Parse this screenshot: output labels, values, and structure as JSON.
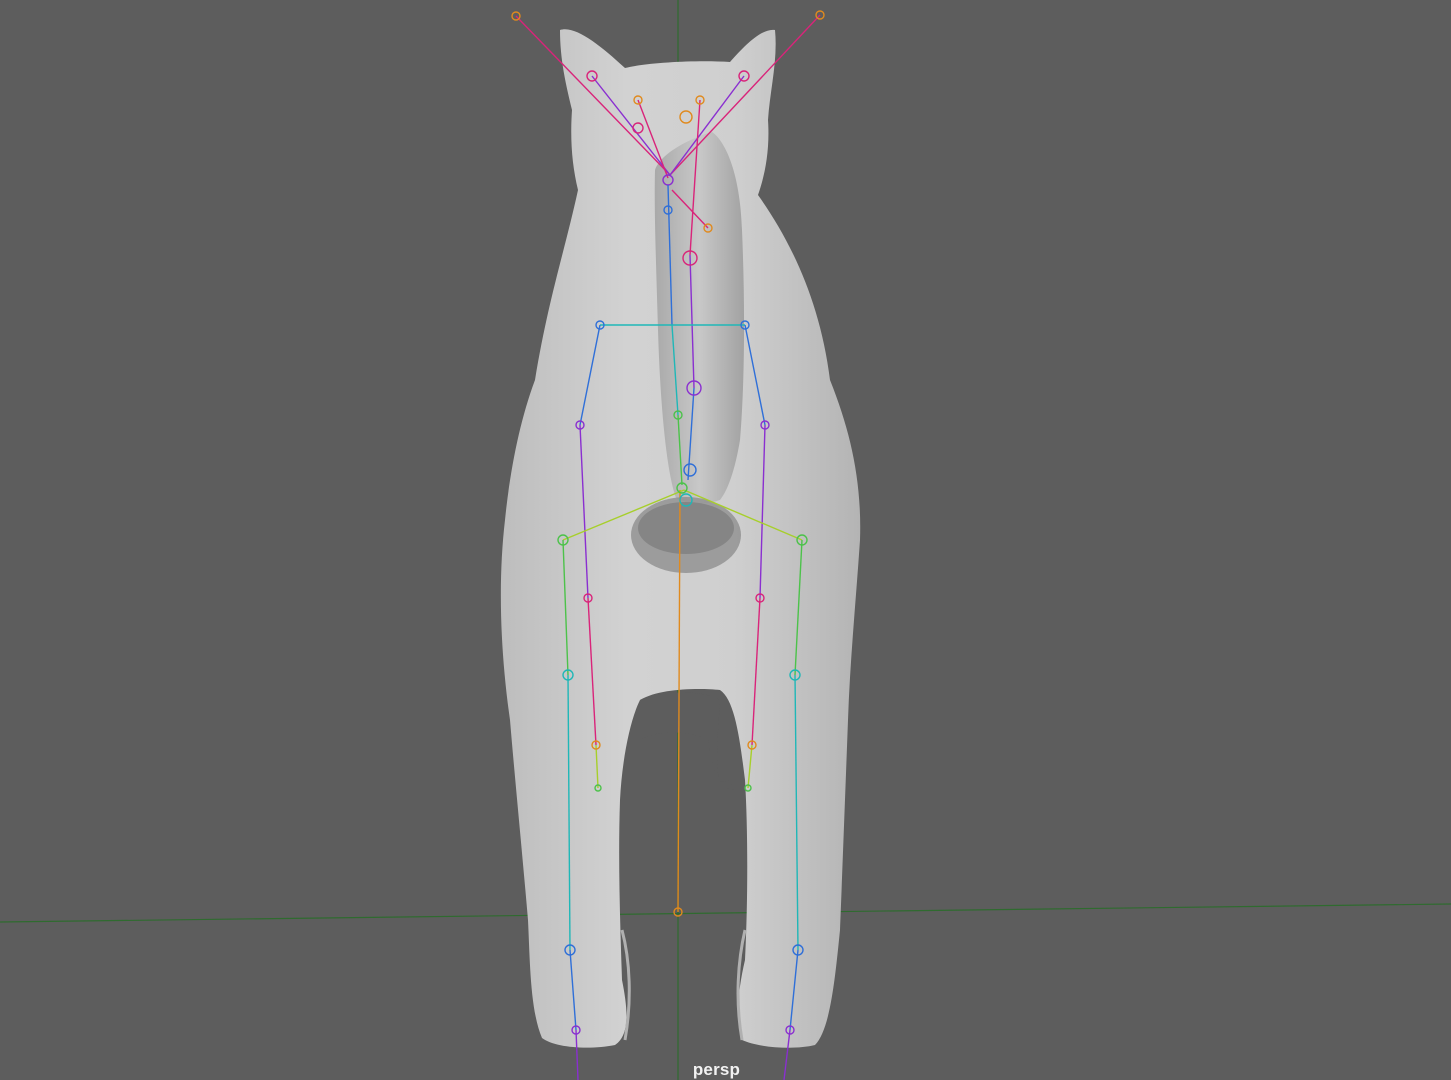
{
  "viewport": {
    "camera_label": "persp",
    "background_color": "#5d5d5d",
    "mesh_color": "#c9c9c9",
    "grid_axis_x_color": "#2f6b2f",
    "grid_axis_z_color": "#3b7a3b"
  },
  "skeleton_colors": {
    "magenta": "#d9247a",
    "purple": "#8a2fd0",
    "blue": "#2f6fd8",
    "cyan": "#1fb7b7",
    "green": "#4cc24a",
    "lime": "#a7cf2b",
    "orange": "#e08a1e",
    "yellow": "#d8d820"
  }
}
